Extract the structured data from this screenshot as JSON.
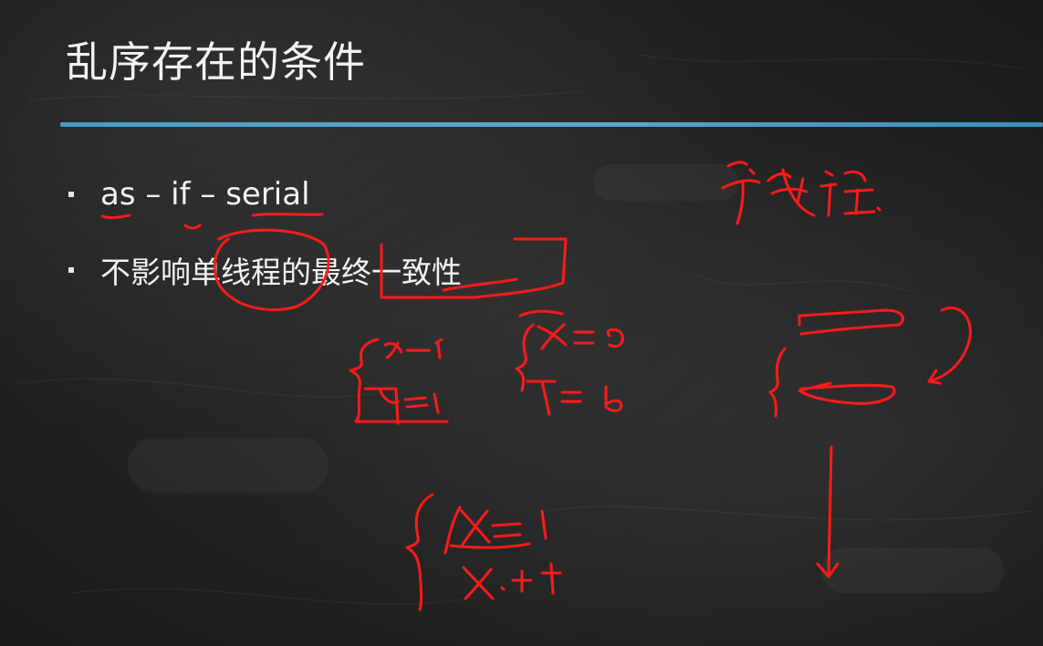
{
  "slide": {
    "title": "乱序存在的条件",
    "bullets": [
      "as – if – serial",
      "不影响单线程的最终一致性"
    ]
  },
  "annotations": {
    "ink_color": "#ff1a1a",
    "handwriting": [
      "单线程",
      "x=1",
      "y=1",
      "x=a",
      "y=b",
      "x=1",
      "x++"
    ]
  },
  "colors": {
    "background": "#222222",
    "text": "#f2f2f2",
    "accent_rule": "#4aa3d8"
  }
}
